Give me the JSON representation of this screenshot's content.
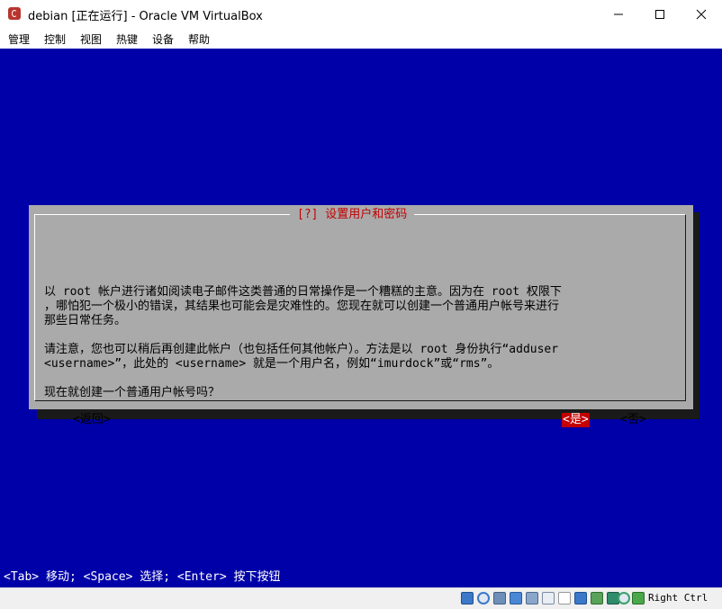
{
  "window": {
    "title": "debian [正在运行] - Oracle VM VirtualBox"
  },
  "menu": [
    "管理",
    "控制",
    "视图",
    "热键",
    "设备",
    "帮助"
  ],
  "dialog": {
    "title": "[?] 设置用户和密码",
    "lines": [
      "以 root 帐户进行诸如阅读电子邮件这类普通的日常操作是一个糟糕的主意。因为在 root 权限下",
      "，哪怕犯一个极小的错误，其结果也可能会是灾难性的。您现在就可以创建一个普通用户帐号来进行",
      "那些日常任务。",
      "请注意，您也可以稍后再创建此帐户（也包括任何其他帐户）。方法是以 root 身份执行“adduser",
      "<username>”，此处的 <username> 就是一个用户名，例如“imurdock”或“rms”。",
      "现在就创建一个普通用户帐号吗？"
    ],
    "buttons": {
      "back": "<返回>",
      "yes": "<是>",
      "no": "<否>"
    }
  },
  "hint": "<Tab> 移动; <Space> 选择; <Enter> 按下按钮",
  "statusbar": {
    "host_key": "Right Ctrl",
    "icons": [
      "hard-disk-icon",
      "optical-drive-icon",
      "audio-icon",
      "network-icon",
      "usb-icon",
      "shared-folder-icon",
      "display-icon",
      "video-capture-icon",
      "green-screen-icon",
      "cpu-icon",
      "mouse-integration-icon",
      "down-arrow-icon"
    ]
  },
  "colors": {
    "vm_background": "#0000a8",
    "dialog_background": "#aaaaaa",
    "accent_red": "#c40000"
  }
}
